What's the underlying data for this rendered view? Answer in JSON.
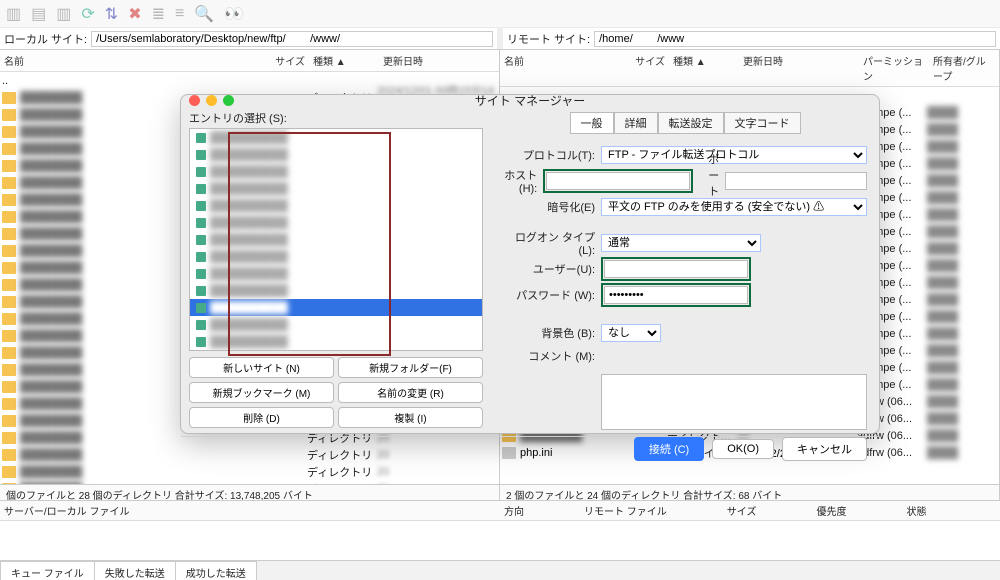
{
  "paths": {
    "local_label": "ローカル サイト:",
    "local_value": "/Users/semlaboratory/Desktop/new/ftp/        /www/",
    "remote_label": "リモート サイト:",
    "remote_value": "/home/        /www"
  },
  "columns": {
    "name": "名前",
    "size": "サイズ",
    "type": "種類 ▲",
    "date": "更新日時",
    "perm": "パーミッション",
    "owner": "所有者/グループ"
  },
  "left_rows": [
    {
      "type": "ディレクトリ",
      "date": "2024/12/01 00時15分14秒"
    },
    {
      "type": "ディレクトリ",
      "date": "20"
    },
    {
      "type": "ディレクトリ",
      "date": "20"
    },
    {
      "type": "ディレクトリ",
      "date": "20"
    }
  ],
  "right_rows_prefix": "ディレクト...",
  "right_rows_date": "20",
  "right_perm": "flcdmpe (...",
  "right_perm_alt": "adfrw (06...",
  "right_special_row": {
    "name": "php.ini",
    "size": "68",
    "type": "ini-ファイル",
    "date": "2024/12/22 19時5"
  },
  "right_count": 20,
  "status_left": "個のファイルと 28 個のディレクトリ 合計サイズ: 13,748,205 バイト",
  "status_right": "2 個のファイルと 24 個のディレクトリ 合計サイズ: 68 バイト",
  "queue_headers": {
    "left": "サーバー/ローカル ファイル",
    "dir": "方向",
    "rfile": "リモート ファイル",
    "size": "サイズ",
    "prio": "優先度",
    "stat": "状態"
  },
  "tabs_bottom": {
    "queue": "キュー ファイル",
    "failed": "失敗した転送",
    "success": "成功した転送"
  },
  "dialog": {
    "title": "サイト マネージャー",
    "entries_label": "エントリの選択 (S):",
    "entry_count": 13,
    "selected_index": 10,
    "buttons": {
      "new_site": "新しいサイト (N)",
      "new_folder": "新規フォルダー(F)",
      "new_bookmark": "新規ブックマーク (M)",
      "rename": "名前の変更 (R)",
      "delete": "削除 (D)",
      "duplicate": "複製 (I)"
    },
    "form_tabs": {
      "general": "一般",
      "advanced": "詳細",
      "transfer": "転送設定",
      "charset": "文字コード"
    },
    "labels": {
      "protocol": "プロトコル(T):",
      "host": "ホスト (H):",
      "port": "ポート (P):",
      "encryption": "暗号化(E)",
      "logon_type": "ログオン タイプ(L):",
      "user": "ユーザー(U):",
      "password": "パスワード (W):",
      "bgcolor": "背景色 (B):",
      "comment": "コメント (M):"
    },
    "values": {
      "protocol": "FTP - ファイル転送プロトコル",
      "host": "",
      "port": "",
      "encryption": "平文の FTP のみを使用する (安全でない) ⚠",
      "logon_type": "通常",
      "user": "",
      "password": "•••••••••",
      "bgcolor": "なし"
    },
    "footer": {
      "connect": "接続 (C)",
      "ok": "OK(O)",
      "cancel": "キャンセル"
    }
  }
}
